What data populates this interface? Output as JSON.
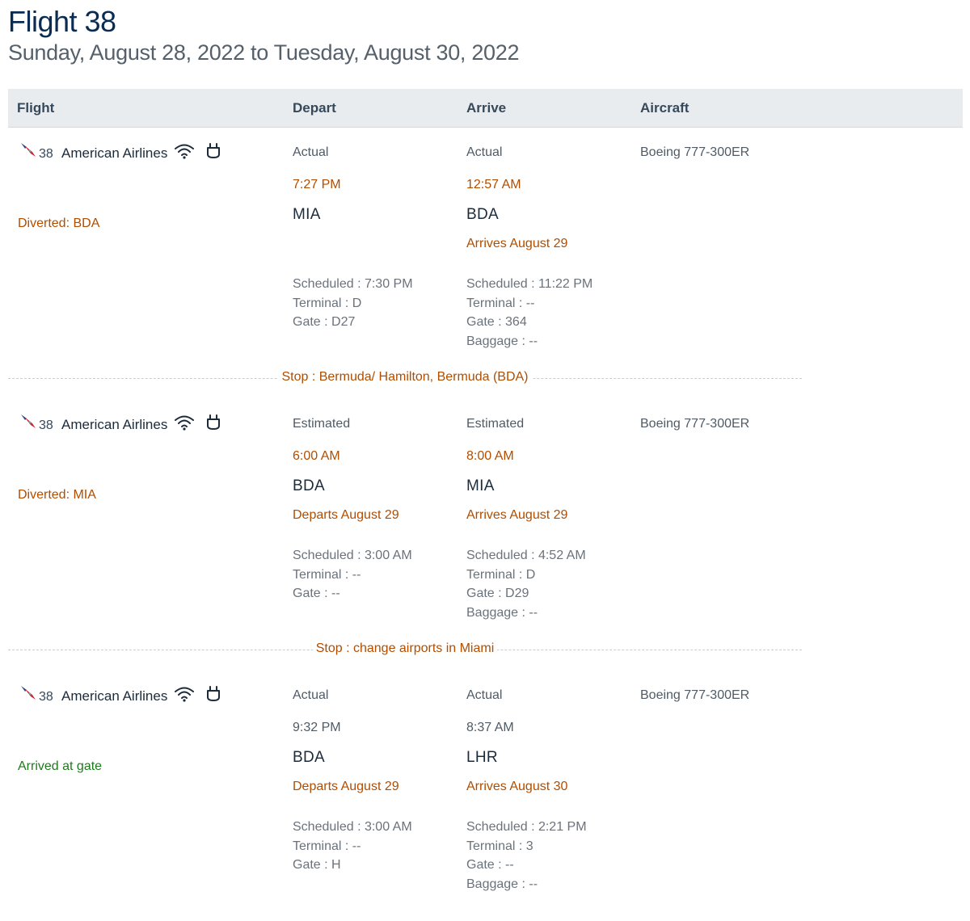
{
  "page": {
    "title": "Flight 38",
    "subtitle": "Sunday, August 28, 2022 to Tuesday, August 30, 2022"
  },
  "table": {
    "headers": [
      "Flight",
      "Depart",
      "Arrive",
      "Aircraft"
    ]
  },
  "segments": [
    {
      "flight_number": "38",
      "airline": "American Airlines",
      "status": "Diverted: BDA",
      "aircraft": "Boeing 777-300ER",
      "depart": {
        "label": "Actual",
        "time": "7:27 PM",
        "code": "MIA",
        "date_note": "",
        "details": [
          "Scheduled : 7:30 PM",
          "Terminal : D",
          "Gate : D27"
        ]
      },
      "arrive": {
        "label": "Actual",
        "time": "12:57 AM",
        "code": "BDA",
        "date_note": "Arrives August 29",
        "details": [
          "Scheduled : 11:22 PM",
          "Terminal : --",
          "Gate : 364",
          "Baggage : --"
        ]
      }
    },
    {
      "flight_number": "38",
      "airline": "American Airlines",
      "status": "Diverted: MIA",
      "aircraft": "Boeing 777-300ER",
      "depart": {
        "label": "Estimated",
        "time": "6:00 AM",
        "code": "BDA",
        "date_note": "Departs August 29",
        "details": [
          "Scheduled : 3:00 AM",
          "Terminal : --",
          "Gate : --"
        ]
      },
      "arrive": {
        "label": "Estimated",
        "time": "8:00 AM",
        "code": "MIA",
        "date_note": "Arrives August 29",
        "details": [
          "Scheduled : 4:52 AM",
          "Terminal : D",
          "Gate : D29",
          "Baggage : --"
        ]
      }
    },
    {
      "flight_number": "38",
      "airline": "American Airlines",
      "status": "Arrived at gate",
      "aircraft": "Boeing 777-300ER",
      "depart": {
        "label": "Actual",
        "time": "9:32 PM",
        "code": "BDA",
        "date_note": "Departs August 29",
        "details": [
          "Scheduled : 3:00 AM",
          "Terminal : --",
          "Gate : H"
        ]
      },
      "arrive": {
        "label": "Actual",
        "time": "8:37 AM",
        "code": "LHR",
        "date_note": "Arrives August 30",
        "details": [
          "Scheduled : 2:21 PM",
          "Terminal : 3",
          "Gate : --",
          "Baggage : --"
        ]
      }
    }
  ],
  "stops": [
    "Stop : Bermuda/ Hamilton, Bermuda (BDA)",
    "Stop : change airports in Miami"
  ],
  "icons": [
    "american-airlines-logo-icon",
    "wifi-icon",
    "power-outlet-icon"
  ],
  "colors": {
    "title": "#0b2c52",
    "header_bg": "#e9ecee",
    "highlight_orange": "#b24d00",
    "status_green": "#1f7a1f"
  }
}
